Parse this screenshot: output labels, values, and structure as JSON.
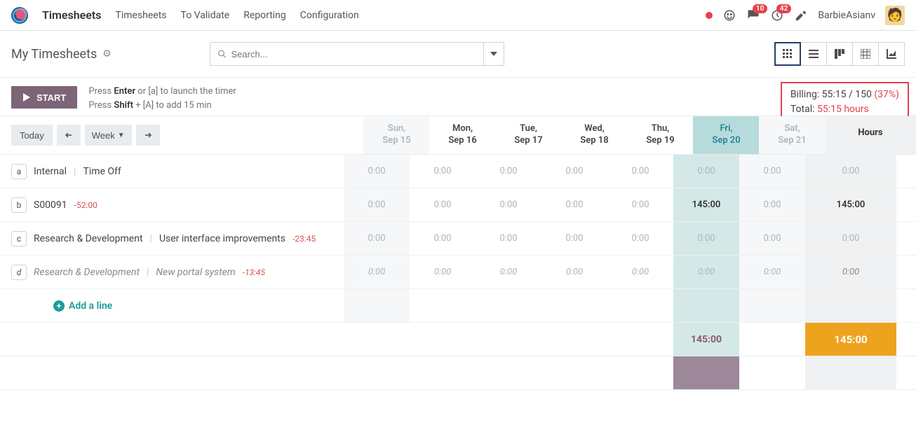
{
  "app": {
    "name": "Timesheets"
  },
  "nav": [
    "Timesheets",
    "To Validate",
    "Reporting",
    "Configuration"
  ],
  "topbar": {
    "msg_badge": "10",
    "activity_badge": "42",
    "user": "BarbieAsianv"
  },
  "page": {
    "title": "My Timesheets",
    "search_placeholder": "Search..."
  },
  "actions": {
    "start_label": "START",
    "hint1_prefix": "Press ",
    "hint1_bold": "Enter",
    "hint1_suffix": " or [a] to launch the timer",
    "hint2_prefix": "Press ",
    "hint2_bold": "Shift",
    "hint2_suffix": " + [A] to add 15 min"
  },
  "billing": {
    "billing_label": "Billing: ",
    "billing_value": "55:15 / 150 ",
    "billing_pct": "(37%)",
    "total_label": "Total: ",
    "total_value": "55:15 hours"
  },
  "date_nav": {
    "today_label": "Today",
    "period_label": "Week"
  },
  "days": [
    {
      "dow": "Sun,",
      "date": "Sep 15",
      "style": "grey"
    },
    {
      "dow": "Mon,",
      "date": "Sep 16",
      "style": ""
    },
    {
      "dow": "Tue,",
      "date": "Sep 17",
      "style": ""
    },
    {
      "dow": "Wed,",
      "date": "Sep 18",
      "style": ""
    },
    {
      "dow": "Thu,",
      "date": "Sep 19",
      "style": ""
    },
    {
      "dow": "Fri,",
      "date": "Sep 20",
      "style": "today"
    },
    {
      "dow": "Sat,",
      "date": "Sep 21",
      "style": "grey"
    }
  ],
  "hours_header": "Hours",
  "rows": [
    {
      "key": "a",
      "project": "Internal",
      "task": "Time Off",
      "overtime": "",
      "italic": false,
      "cells": [
        "0:00",
        "0:00",
        "0:00",
        "0:00",
        "0:00",
        "0:00",
        "0:00"
      ],
      "hours": "0:00",
      "has_val_idx": -1
    },
    {
      "key": "b",
      "project": "S00091",
      "task": "",
      "overtime": "-52:00",
      "italic": false,
      "cells": [
        "0:00",
        "0:00",
        "0:00",
        "0:00",
        "0:00",
        "145:00",
        "0:00"
      ],
      "hours": "145:00",
      "has_val_idx": 5
    },
    {
      "key": "c",
      "project": "Research & Development",
      "task": "User interface improvements",
      "overtime": "-23:45",
      "italic": false,
      "cells": [
        "0:00",
        "0:00",
        "0:00",
        "0:00",
        "0:00",
        "0:00",
        "0:00"
      ],
      "hours": "0:00",
      "has_val_idx": -1
    },
    {
      "key": "d",
      "project": "Research & Development",
      "task": "New portal system",
      "overtime": "-13:45",
      "italic": true,
      "cells": [
        "0:00",
        "0:00",
        "0:00",
        "0:00",
        "0:00",
        "0:00",
        "0:00"
      ],
      "hours": "0:00",
      "has_val_idx": -1
    }
  ],
  "add_line_label": "Add a line",
  "totals": {
    "cells": [
      "",
      "",
      "",
      "",
      "",
      "145:00",
      ""
    ],
    "hours": "145:00"
  }
}
